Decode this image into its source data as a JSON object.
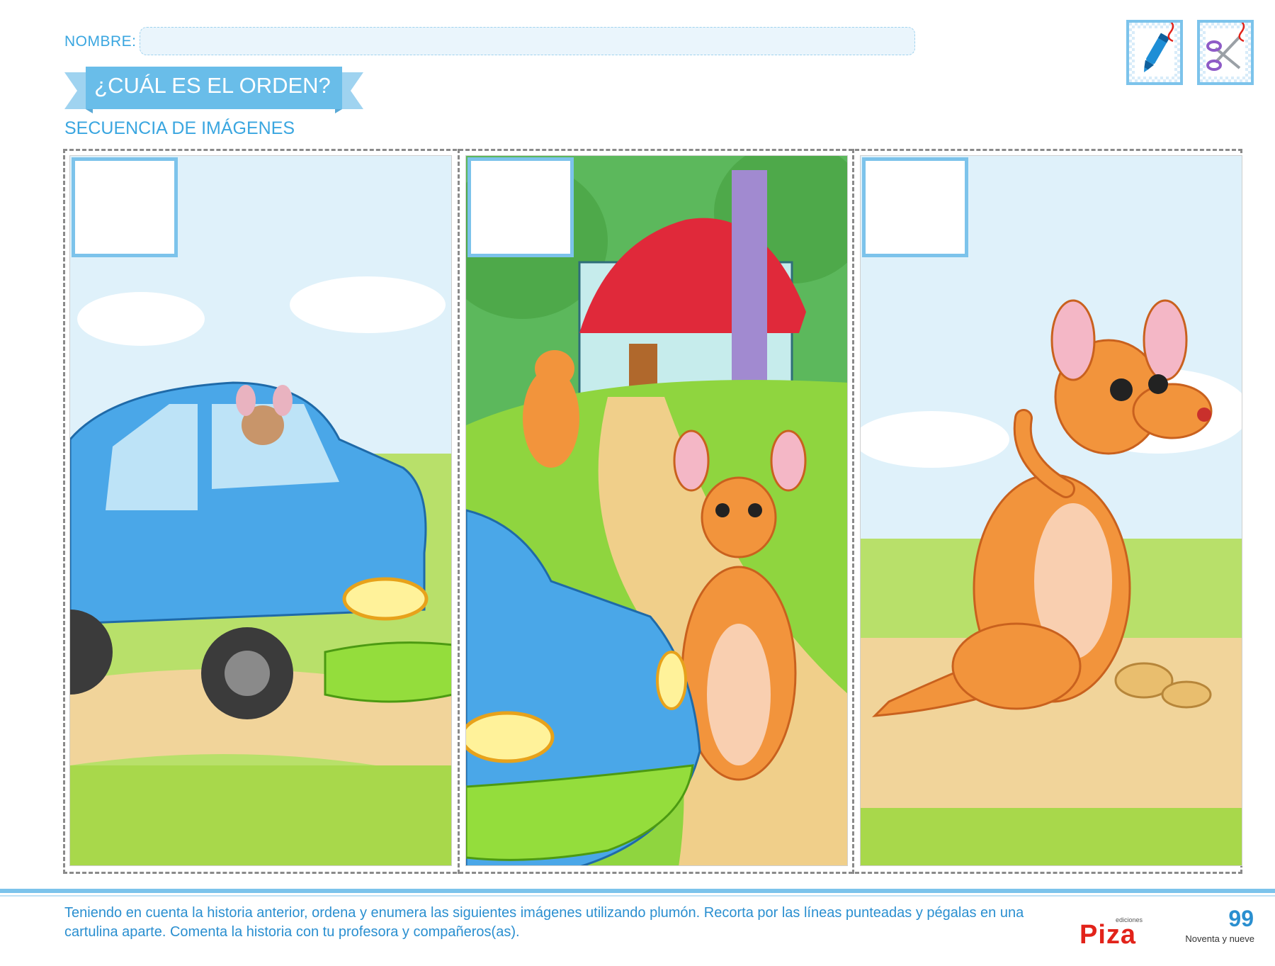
{
  "header": {
    "name_label": "NOMBRE:",
    "title": "¿CUÁL ES EL ORDEN?",
    "subtitle": "SECUENCIA DE IMÁGENES"
  },
  "tools": [
    {
      "icon": "marker-icon"
    },
    {
      "icon": "scissors-icon"
    }
  ],
  "panels": [
    {
      "scene": "blue car with kangaroo driving"
    },
    {
      "scene": "kangaroos near house with car"
    },
    {
      "scene": "kangaroo waving"
    }
  ],
  "footer": {
    "instructions": "Teniendo en cuenta la historia anterior, ordena y enumera las siguientes imágenes utilizando plumón. Recorta por las líneas punteadas y pégalas en una cartulina aparte. Comenta la historia con tu profesora y compañeros(as).",
    "logo_text": "Piza",
    "logo_small": "ediciones",
    "page_number": "99",
    "page_words": "Noventa y nueve"
  },
  "colors": {
    "accent": "#7cc3eb",
    "text_blue": "#2a8fd0",
    "logo_red": "#e2231a"
  }
}
